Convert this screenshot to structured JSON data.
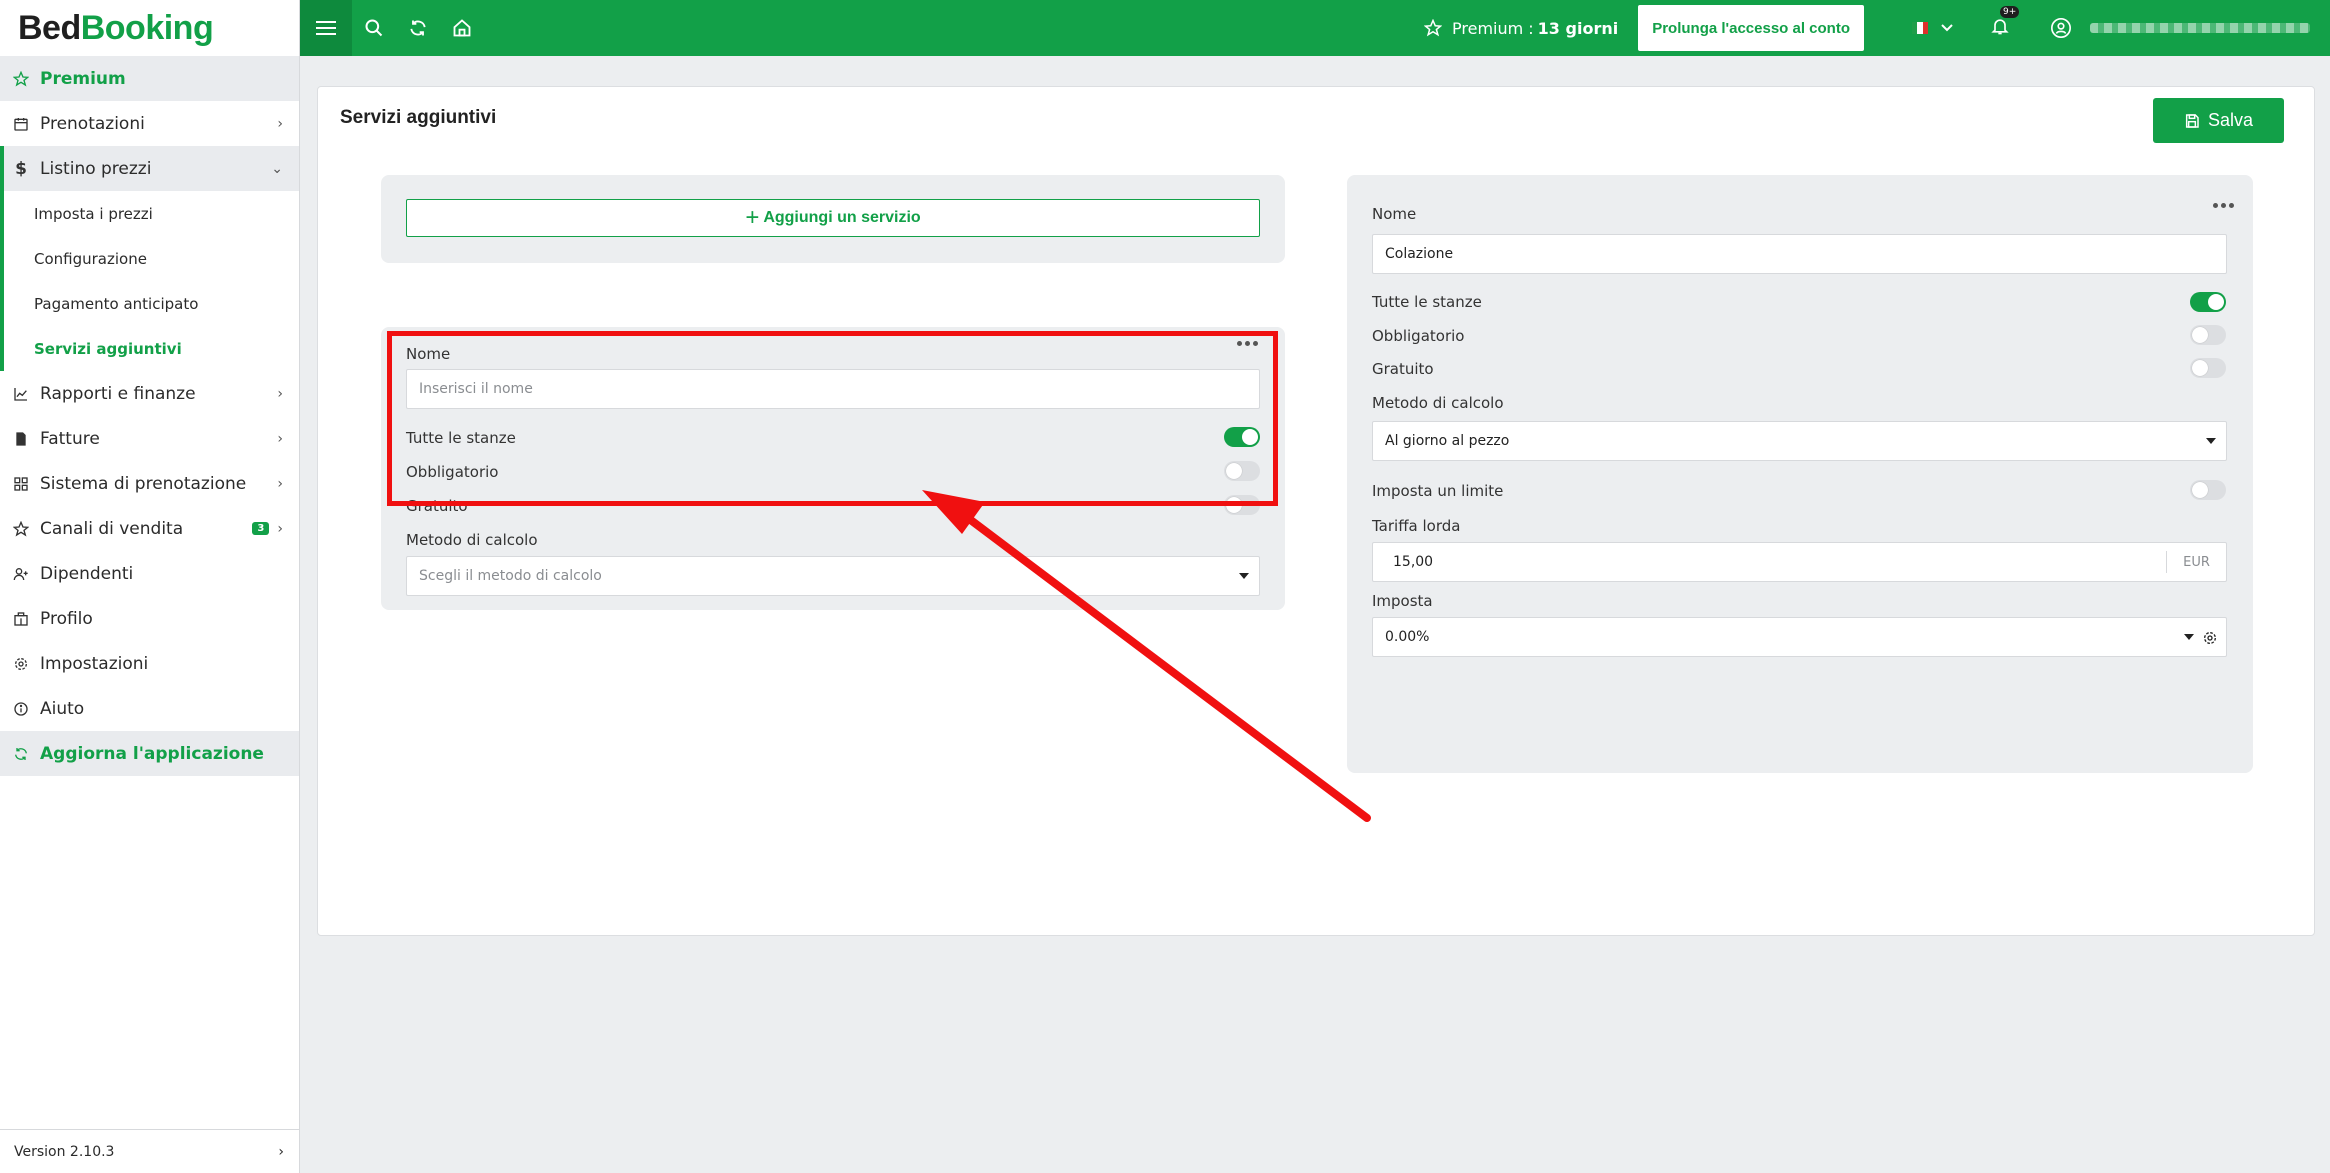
{
  "logo": {
    "part1": "Bed",
    "part2": "Booking"
  },
  "sidebar": {
    "premium": "Premium",
    "reservations": "Prenotazioni",
    "price_list": "Listino prezzi",
    "sub": [
      "Imposta i prezzi",
      "Configurazione",
      "Pagamento anticipato",
      "Servizi aggiuntivi"
    ],
    "reports": "Rapporti e finanze",
    "invoices": "Fatture",
    "booking_system": "Sistema di prenotazione",
    "sales_channels": "Canali di vendita",
    "sales_channels_badge": "3",
    "employees": "Dipendenti",
    "profile": "Profilo",
    "settings": "Impostazioni",
    "help": "Aiuto",
    "update_app": "Aggiorna l'applicazione",
    "version": "Version 2.10.3"
  },
  "topbar": {
    "premium_label": "Premium :",
    "premium_days": "13 giorni",
    "prolong_button": "Prolunga l'accesso al conto",
    "notifications_count": "9+"
  },
  "main": {
    "title": "Servizi aggiuntivi",
    "save_label": "Salva",
    "add_service_label": "Aggiungi un servizio",
    "new_service": {
      "name_label": "Nome",
      "name_placeholder": "Inserisci il nome",
      "all_rooms_label": "Tutte le stanze",
      "all_rooms": true,
      "mandatory_label": "Obbligatorio",
      "mandatory": false,
      "free_label": "Gratuito",
      "free": false,
      "calc_method_label": "Metodo di calcolo",
      "calc_method_placeholder": "Scegli il metodo di calcolo"
    },
    "existing_service": {
      "name_label": "Nome",
      "name_value": "Colazione",
      "all_rooms_label": "Tutte le stanze",
      "all_rooms": true,
      "mandatory_label": "Obbligatorio",
      "mandatory": false,
      "free_label": "Gratuito",
      "free": false,
      "calc_method_label": "Metodo di calcolo",
      "calc_method_value": "Al giorno al pezzo",
      "set_limit_label": "Imposta un limite",
      "set_limit": false,
      "gross_rate_label": "Tariffa lorda",
      "gross_rate_value": "15,00",
      "currency": "EUR",
      "tax_label": "Imposta",
      "tax_value": "0.00%"
    }
  },
  "colors": {
    "accent": "#12a048",
    "highlight": "#f01010"
  }
}
